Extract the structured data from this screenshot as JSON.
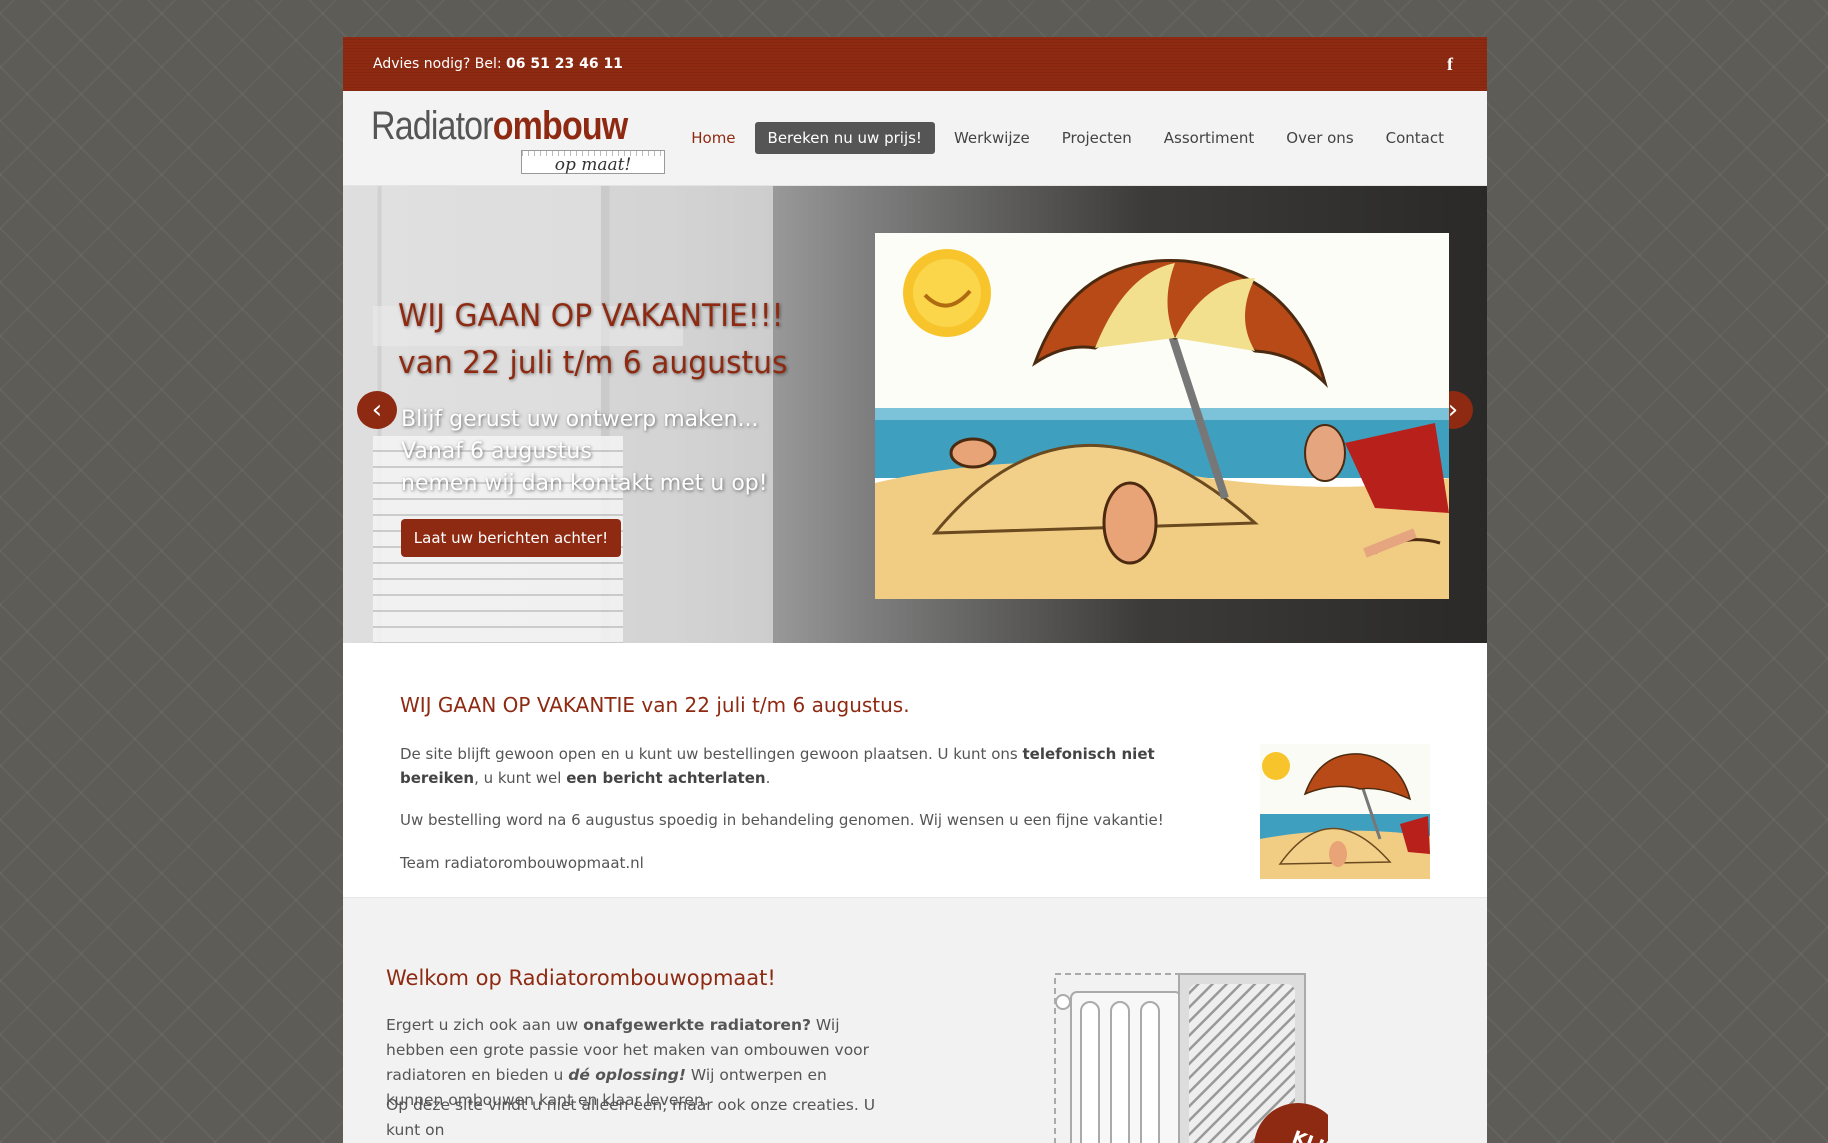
{
  "topbar": {
    "advice_label": "Advies nodig? Bel:",
    "phone": "06 51 23 46 11",
    "facebook_icon": "facebook-icon"
  },
  "logo": {
    "part1": "Radiator",
    "part2": "ombouw",
    "tagline": "op maat!"
  },
  "nav": {
    "items": [
      {
        "label": "Home"
      },
      {
        "label": "Bereken nu uw prijs!"
      },
      {
        "label": "Werkwijze"
      },
      {
        "label": "Projecten"
      },
      {
        "label": "Assortiment"
      },
      {
        "label": "Over ons"
      },
      {
        "label": "Contact"
      }
    ]
  },
  "hero": {
    "title_line1": "WIJ GAAN OP VAKANTIE!!!",
    "title_line2": "van 22 juli t/m 6 augustus",
    "sub_line1": "Blijf gerust uw ontwerp maken...",
    "sub_line2": "Vanaf 6 augustus",
    "sub_line3": "nemen wij dan kontakt met u op!",
    "button": "Laat uw berichten achter!",
    "prev": "‹",
    "next": "›"
  },
  "announcement": {
    "title": "WIJ GAAN OP VAKANTIE van 22 juli t/m 6 augustus.",
    "p1_a": "De site blijft gewoon open en u kunt uw bestellingen gewoon plaatsen. U kunt ons ",
    "p1_b": "telefonisch niet bereiken",
    "p1_c": ", u kunt wel ",
    "p1_d": "een bericht achterlaten",
    "p1_e": ".",
    "p2": "Uw bestelling word na 6 augustus spoedig in behandeling genomen. Wij wensen u een fijne vakantie!",
    "p3": "Team radiatorombouwopmaat.nl"
  },
  "welcome": {
    "title": "Welkom op Radiatorombouwopmaat!",
    "p1_a": "Ergert u zich ook aan uw ",
    "p1_b": "onafgewerkte radiatoren?",
    "p1_c": " Wij hebben een grote passie voor het maken van ombouwen voor radiatoren en bieden u ",
    "p1_d": "dé oplossing!",
    "p1_e": " Wij ontwerpen en kunnen ombouwen kant en klaar leveren.",
    "p2": "Op deze site vindt u niet alleen een, maar ook onze creaties. U kunt on",
    "badge": "KLIK"
  },
  "colors": {
    "brand": "#8e2a12",
    "cta": "#555555",
    "background": "#5d5c57"
  }
}
